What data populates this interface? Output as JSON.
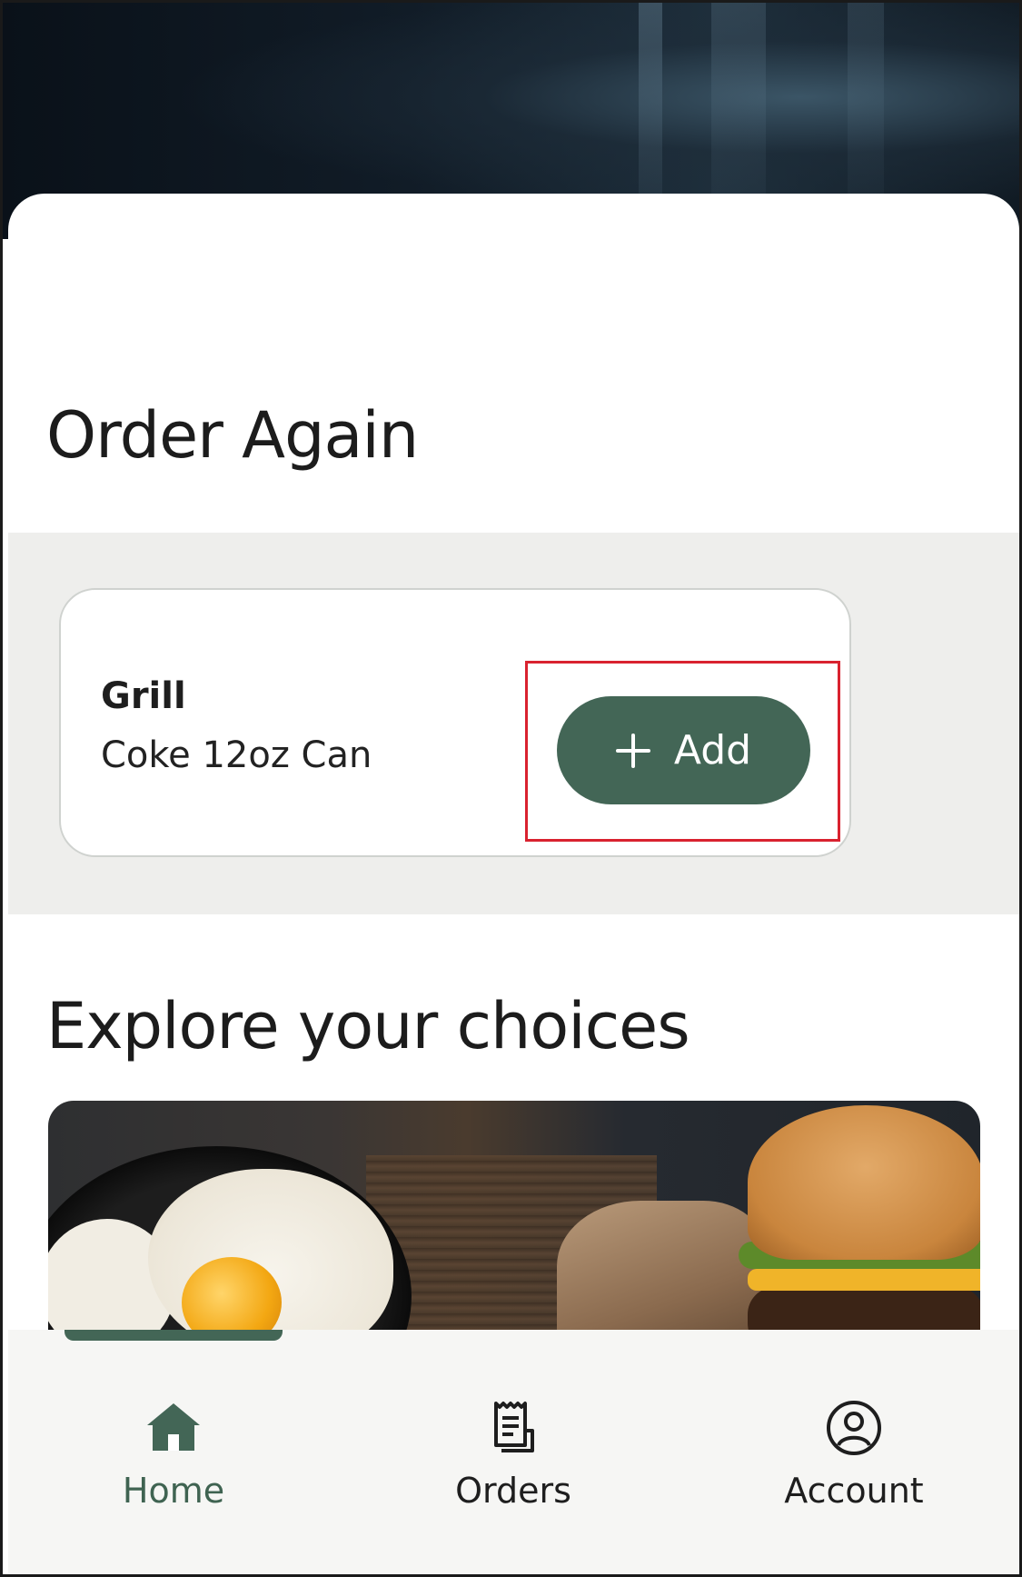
{
  "sections": {
    "order_again_title": "Order Again",
    "explore_title": "Explore your choices"
  },
  "order_again": {
    "vendor": "Grill",
    "item": "Coke 12oz Can",
    "add_label": "Add",
    "add_icon": "plus-icon"
  },
  "banner": {
    "icon": "food-banner-image"
  },
  "nav": {
    "items": [
      {
        "label": "Home",
        "icon": "home-icon",
        "active": true
      },
      {
        "label": "Orders",
        "icon": "receipt-icon",
        "active": false
      },
      {
        "label": "Account",
        "icon": "account-icon",
        "active": false
      }
    ]
  },
  "colors": {
    "accent": "#436656",
    "highlight": "#d9222f",
    "band": "#eeeeec"
  }
}
